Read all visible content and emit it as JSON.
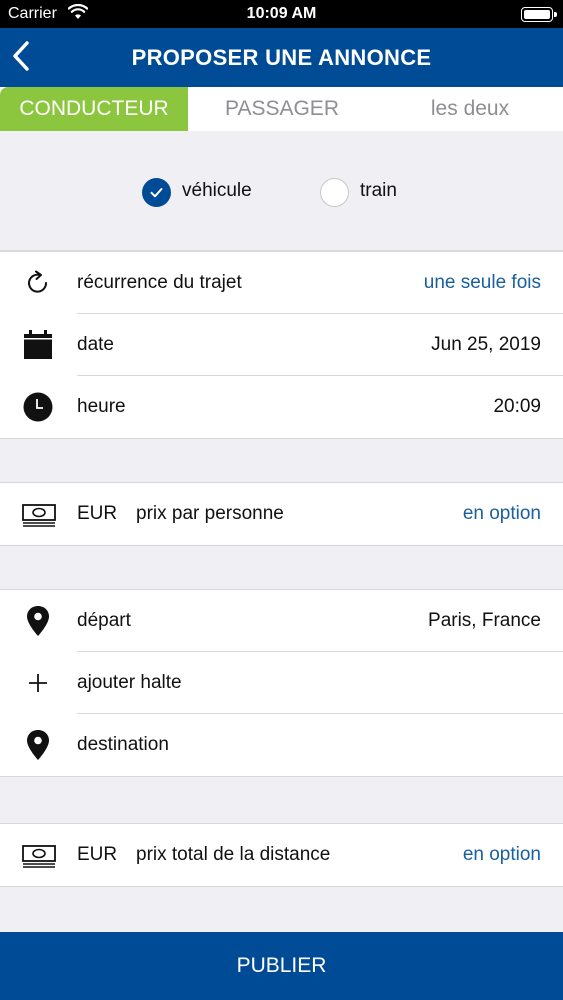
{
  "status_bar": {
    "carrier": "Carrier",
    "time": "10:09 AM"
  },
  "nav": {
    "title": "PROPOSER UNE ANNONCE",
    "back_icon": "chevron-left-icon"
  },
  "tabs": [
    {
      "label": "CONDUCTEUR",
      "active": true
    },
    {
      "label": "PASSAGER",
      "active": false
    },
    {
      "label": "les deux",
      "active": false
    }
  ],
  "transport": {
    "options": [
      {
        "label": "véhicule",
        "checked": true
      },
      {
        "label": "train",
        "checked": false
      }
    ]
  },
  "schedule": {
    "recurrence": {
      "label": "récurrence du trajet",
      "value": "une seule fois",
      "icon": "refresh-icon"
    },
    "date": {
      "label": "date",
      "value": "Jun 25, 2019",
      "icon": "calendar-icon"
    },
    "time": {
      "label": "heure",
      "value": "20:09",
      "icon": "clock-icon"
    }
  },
  "price_person": {
    "currency": "EUR",
    "label": "prix par personne",
    "value": "en option",
    "icon": "money-icon"
  },
  "route": {
    "departure": {
      "label": "départ",
      "value": "Paris, France",
      "icon": "location-pin-icon"
    },
    "add_stop": {
      "label": "ajouter halte",
      "icon": "plus-icon"
    },
    "destination": {
      "label": "destination",
      "icon": "location-pin-icon"
    }
  },
  "price_total": {
    "currency": "EUR",
    "label": "prix total de la distance",
    "value": "en option",
    "icon": "money-icon"
  },
  "publish_button": {
    "label": "PUBLIER"
  },
  "colors": {
    "primary": "#004b96",
    "accent_green": "#8cc63f",
    "link": "#1a5fa0",
    "background": "#efeff4"
  }
}
